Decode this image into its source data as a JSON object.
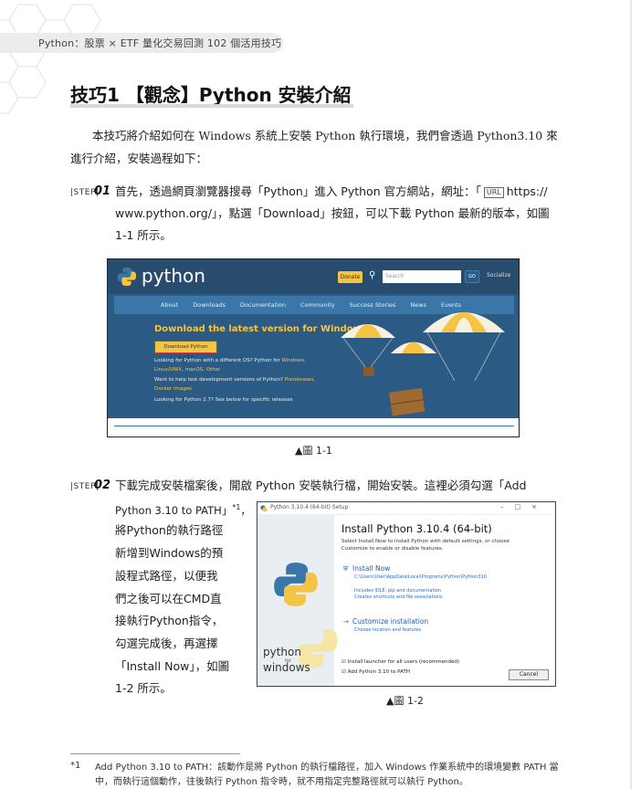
{
  "header": {
    "book_title": "Python：股票 × ETF 量化交易回測 102 個活用技巧"
  },
  "section": {
    "title": "技巧1 【觀念】Python 安裝介紹"
  },
  "intro": "本技巧將介紹如何在 Windows 系統上安裝 Python 執行環境，我們會透過 Python3.10 來進行介紹，安裝過程如下：",
  "steps": [
    {
      "label": "STEP",
      "number": "01",
      "text_before_url": "首先，透過網頁瀏覽器搜尋「Python」進入 Python 官方網站，網址：「",
      "url_badge": "URL",
      "url_part1": "https://",
      "line2": "www.python.org/」，點選「Download」按鈕，可以下載 Python 最新的版本，如圖",
      "line3": "1-1 所示。"
    },
    {
      "label": "STEP",
      "number": "02",
      "line1": "下載完成安裝檔案後，開啟 Python 安裝執行檔，開始安裝。這裡必須勾選「Add",
      "line2": "Python 3.10 to PATH」",
      "footnote_ref": "*1",
      "line2_tail": "，",
      "lines": [
        "將Python的執行路徑",
        "新增到Windows的預",
        "設程式路徑，以便我",
        "們之後可以在CMD直",
        "接執行Python指令，",
        "勾選完成後，再選擇",
        "「Install Now」，如圖",
        "1-2 所示。"
      ]
    }
  ],
  "figure1": {
    "caption": "▲圖 1-1",
    "logo_text": "python",
    "donate_label": "Donate",
    "search_placeholder": "Search",
    "go_label": "GO",
    "socialize_label": "Socialize",
    "nav_items": [
      "About",
      "Downloads",
      "Documentation",
      "Community",
      "Success Stories",
      "News",
      "Events"
    ],
    "headline": "Download the latest version for Windows",
    "download_button": "Download Python 3.10.4",
    "line1": "Looking for Python with a different OS? Python for ",
    "line1_links": "Windows,",
    "line2": "Linux/UNIX, macOS, Other",
    "line3_a": "Want to help test development versions of Python? ",
    "line3_link": "Prereleases,",
    "line4": "Docker images",
    "line5": "Looking for Python 2.7? See below for specific releases"
  },
  "figure2": {
    "caption": "▲圖 1-2",
    "window_title": "Python 3.10.4 (64-bit) Setup",
    "install_title": "Install Python 3.10.4 (64-bit)",
    "sub1": "Select Install Now to install Python with default settings, or choose",
    "sub2": "Customize to enable or disable features.",
    "install_now": "Install Now",
    "install_path": "C:\\Users\\User\\AppData\\Local\\Programs\\Python\\Python310",
    "includes1": "Includes IDLE, pip and documentation",
    "includes2": "Creates shortcuts and file associations",
    "customize": "Customize installation",
    "customize_sub": "Choose location and features",
    "chk1": "Install launcher for all users (recommended)",
    "chk2": "Add Python 3.10 to PATH",
    "cancel": "Cancel",
    "side_text1": "python",
    "side_for": "for",
    "side_text2": "windows"
  },
  "footnote": {
    "mark": "*1",
    "text": "Add Python 3.10 to PATH：該動作是將 Python 的執行檔路徑，加入 Windows 作業系統中的環境變數 PATH 當中，而執行這個動作，往後執行 Python 指令時，就不用指定完整路徑就可以執行 Python。"
  },
  "colors": {
    "python_blue": "#2b5b84",
    "python_yellow": "#f5c443",
    "nav_blue": "#3a76a8"
  }
}
